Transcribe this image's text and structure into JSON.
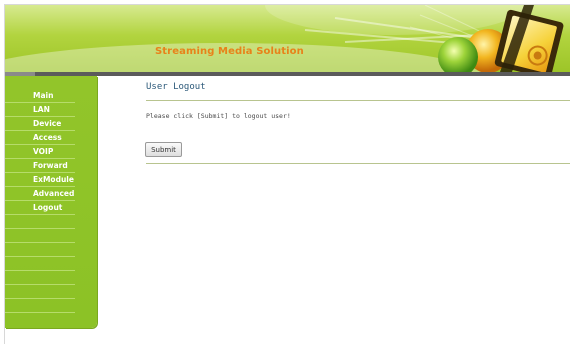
{
  "header": {
    "brand": "Streaming Media Solution"
  },
  "sidebar": {
    "items": [
      {
        "label": "Main"
      },
      {
        "label": "LAN"
      },
      {
        "label": "Device"
      },
      {
        "label": "Access"
      },
      {
        "label": "VOIP"
      },
      {
        "label": "Forward"
      },
      {
        "label": "ExModule"
      },
      {
        "label": "Advanced"
      },
      {
        "label": "Logout"
      }
    ]
  },
  "main": {
    "title": "User Logout",
    "message": "Please click [Submit] to logout user!",
    "submit_label": "Submit"
  },
  "colors": {
    "accent_green": "#92c52a",
    "brand_orange": "#e8821a",
    "title_blue": "#2d5a7a"
  }
}
